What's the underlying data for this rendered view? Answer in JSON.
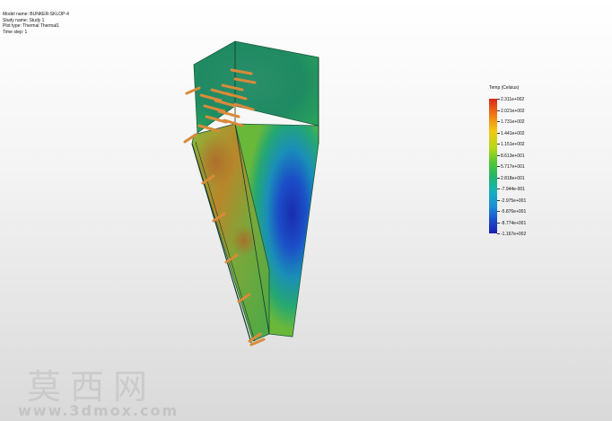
{
  "plot_info": {
    "model_name": "Model name: BUNKER-SKLOP-4",
    "study_name": "Study name: Study 1",
    "plot_type": "Plot type: Thermal Thermal1",
    "time_step": "Time step: 1"
  },
  "legend": {
    "title": "Temp (Celsius)",
    "values": [
      "2.311e+002",
      "2.021e+002",
      "1.731e+002",
      "1.441e+002",
      "1.151e+002",
      "8.613e+001",
      "5.717e+001",
      "2.818e+001",
      "-7.944e-001",
      "-2.975e+001",
      "-5.876e+001",
      "-8.774e+001",
      "-1.167e+002"
    ]
  },
  "colors": {
    "hot": "#d8261a",
    "cold": "#1a20b0",
    "bolt": "#d98a3a"
  },
  "watermark": {
    "logo": "莫西网",
    "url": "www.3dmox.com"
  }
}
